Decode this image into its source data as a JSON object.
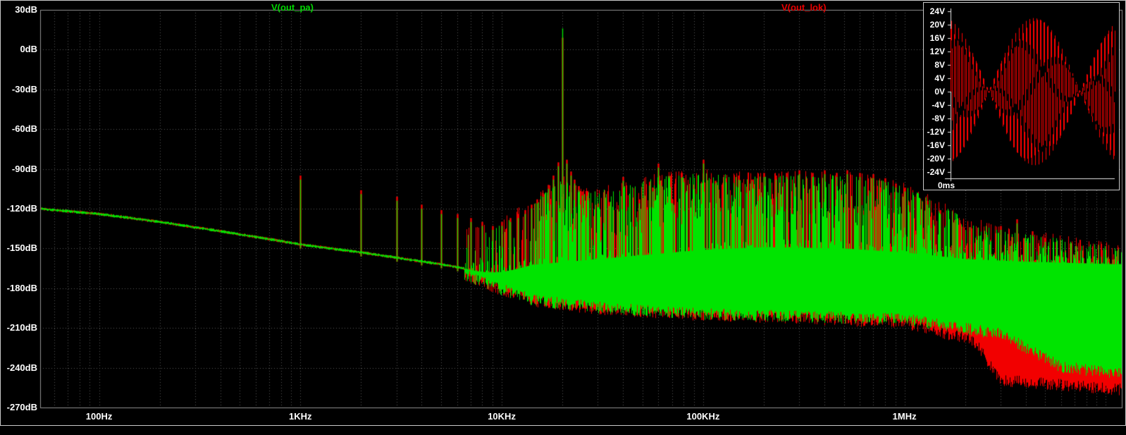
{
  "window": {
    "background": "#000000",
    "frame_color": "#c8c8c8"
  },
  "legend": {
    "pa": {
      "label": "V(out_pa)",
      "color": "#00d800"
    },
    "lok": {
      "label": "V(out_lok)",
      "color": "#e80000"
    }
  },
  "main_axes": {
    "y_tick_labels": [
      "30dB",
      "0dB",
      "-30dB",
      "-60dB",
      "-90dB",
      "-120dB",
      "-150dB",
      "-180dB",
      "-210dB",
      "-240dB",
      "-270dB"
    ],
    "x_tick_labels": [
      "100Hz",
      "1KHz",
      "10KHz",
      "100KHz",
      "1MHz"
    ],
    "x_tick_hz": [
      100,
      1000,
      10000,
      100000,
      1000000
    ],
    "grid_color": "#585858",
    "frame_color": "#909090",
    "label_color": "#ffffff"
  },
  "inset": {
    "y_tick_labels": [
      "24V",
      "20V",
      "16V",
      "12V",
      "8V",
      "4V",
      "0V",
      "-4V",
      "-8V",
      "-12V",
      "-16V",
      "-20V",
      "-24V"
    ],
    "x_label": "0ms",
    "trace_color": "#ff0000",
    "axis_color": "#e8e8e8"
  },
  "chart_data": [
    {
      "type": "line",
      "name": "fft-spectrum",
      "title": "FFT of V(out_pa) and V(out_lok)",
      "x_axis": {
        "scale": "log",
        "unit": "Hz",
        "min_hz": 51,
        "max_hz": 12000000,
        "ticks": [
          [
            100,
            "100Hz"
          ],
          [
            1000,
            "1KHz"
          ],
          [
            10000,
            "10KHz"
          ],
          [
            100000,
            "100KHz"
          ],
          [
            1000000,
            "1MHz"
          ]
        ]
      },
      "y_axis": {
        "unit": "dB",
        "max": 30,
        "min": -270,
        "step": 30,
        "grid": true
      },
      "legend_position": "top",
      "series": [
        {
          "name": "V(out_pa)",
          "color": "#00e400"
        },
        {
          "name": "V(out_lok)",
          "color": "#f20000"
        }
      ],
      "baseline_db": [
        [
          51,
          -120
        ],
        [
          100,
          -124
        ],
        [
          200,
          -130
        ],
        [
          400,
          -137
        ],
        [
          700,
          -143
        ],
        [
          1000,
          -147
        ],
        [
          2000,
          -153
        ],
        [
          3000,
          -157
        ],
        [
          5000,
          -162
        ],
        [
          7000,
          -166
        ],
        [
          10000,
          -171
        ]
      ],
      "noise_band_top_db": [
        [
          7000,
          -168
        ],
        [
          15000,
          -162
        ],
        [
          30000,
          -158
        ],
        [
          60000,
          -154
        ],
        [
          100000,
          -151
        ],
        [
          200000,
          -149
        ],
        [
          500000,
          -150
        ],
        [
          1000000,
          -153
        ],
        [
          2000000,
          -158
        ],
        [
          4000000,
          -160
        ],
        [
          12000000,
          -162
        ]
      ],
      "noise_band_bottom_green_db": [
        [
          7000,
          -178
        ],
        [
          15000,
          -185
        ],
        [
          30000,
          -190
        ],
        [
          60000,
          -193
        ],
        [
          100000,
          -195
        ],
        [
          300000,
          -197
        ],
        [
          1000000,
          -199
        ],
        [
          3000000,
          -210
        ],
        [
          6000000,
          -235
        ],
        [
          12000000,
          -240
        ]
      ],
      "noise_band_bottom_red_db": [
        [
          7000,
          -178
        ],
        [
          15000,
          -186
        ],
        [
          30000,
          -191
        ],
        [
          100000,
          -196
        ],
        [
          300000,
          -198
        ],
        [
          1000000,
          -202
        ],
        [
          2200000,
          -215
        ],
        [
          3000000,
          -245
        ],
        [
          12000000,
          -252
        ]
      ],
      "forest_envelope_db": [
        [
          9000,
          -135
        ],
        [
          15000,
          -112
        ],
        [
          20000,
          -98
        ],
        [
          25000,
          -108
        ],
        [
          40000,
          -103
        ],
        [
          60000,
          -96
        ],
        [
          100000,
          -93
        ],
        [
          200000,
          -96
        ],
        [
          300000,
          -94
        ],
        [
          500000,
          -95
        ],
        [
          700000,
          -97
        ],
        [
          1000000,
          -103
        ],
        [
          1500000,
          -117
        ],
        [
          2000000,
          -127
        ],
        [
          3000000,
          -137
        ],
        [
          5000000,
          -141
        ],
        [
          12000000,
          -150
        ]
      ],
      "peaks_db": [
        [
          1000,
          -98
        ],
        [
          2000,
          -109
        ],
        [
          3000,
          -114
        ],
        [
          4000,
          -120
        ],
        [
          5000,
          -124
        ],
        [
          6000,
          -127
        ],
        [
          7000,
          -130
        ],
        [
          8000,
          -133
        ],
        [
          9000,
          -136
        ],
        [
          10000,
          -133
        ],
        [
          11000,
          -130
        ],
        [
          12000,
          -127
        ],
        [
          13000,
          -124
        ],
        [
          14000,
          -120
        ],
        [
          15000,
          -116
        ],
        [
          16000,
          -111
        ],
        [
          17000,
          -105
        ],
        [
          18000,
          -98
        ],
        [
          19000,
          -88
        ],
        [
          21000,
          -86
        ],
        [
          22000,
          -95
        ],
        [
          23000,
          -101
        ],
        [
          24000,
          -106
        ],
        [
          25000,
          -110
        ],
        [
          27000,
          -115
        ],
        [
          30000,
          -119
        ],
        [
          34000,
          -118
        ],
        [
          40000,
          -99
        ],
        [
          48000,
          -116
        ],
        [
          56000,
          -107
        ],
        [
          60000,
          -89
        ],
        [
          70000,
          -116
        ],
        [
          80000,
          -100
        ],
        [
          90000,
          -108
        ],
        [
          100000,
          -86
        ],
        [
          115000,
          -102
        ],
        [
          130000,
          -100
        ],
        [
          150000,
          -98
        ],
        [
          175000,
          -101
        ],
        [
          200000,
          -96
        ],
        [
          230000,
          -98
        ],
        [
          260000,
          -96
        ],
        [
          300000,
          -94
        ],
        [
          350000,
          -96
        ],
        [
          400000,
          -94
        ],
        [
          460000,
          -96
        ],
        [
          520000,
          -94
        ],
        [
          600000,
          -96
        ],
        [
          700000,
          -97
        ],
        [
          800000,
          -100
        ],
        [
          900000,
          -104
        ],
        [
          1000000,
          -107
        ],
        [
          1150000,
          -112
        ],
        [
          1300000,
          -117
        ],
        [
          1500000,
          -124
        ],
        [
          1800000,
          -131
        ],
        [
          2100000,
          -137
        ],
        [
          2500000,
          -142
        ],
        [
          3000000,
          -136
        ],
        [
          3600000,
          -131
        ],
        [
          4300000,
          -140
        ],
        [
          5000000,
          -145
        ]
      ],
      "main_tone": {
        "hz": 20000,
        "green_db": 16,
        "red_db": 9
      },
      "red_solid_block": {
        "from_hz": 3000000,
        "to_hz": 12000000,
        "top_db": -190,
        "bottom_db": -226
      }
    },
    {
      "type": "line",
      "name": "transient-inset",
      "title": "time-domain beat waveform",
      "series": [
        {
          "name": "V(out_lok)",
          "color": "#ff0000"
        }
      ],
      "y_axis": {
        "unit": "V",
        "max": 24,
        "min": -24,
        "step": 4
      },
      "x_axis": {
        "unit": "ms",
        "first_tick_label": "0ms"
      },
      "waveform": {
        "shape": "amplitude-modulated-sine",
        "amplitude_v": 22,
        "carrier_cycles": 46,
        "envelope_cycles": 0.9,
        "envelope_phase": 0.25
      }
    }
  ]
}
